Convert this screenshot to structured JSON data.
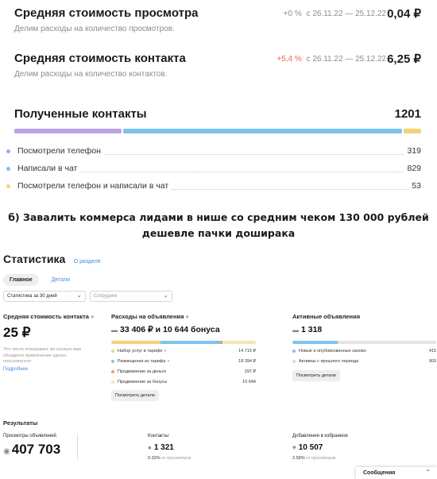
{
  "metrics": [
    {
      "title": "Средняя стоимость просмотра",
      "pct": "+0 %",
      "period": "с 26.11.22 — 25.12.22",
      "value": "0,04 ₽",
      "desc": "Делим расходы на количество просмотров.",
      "pct_color": "#8c8c8c"
    },
    {
      "title": "Средняя стоимость контакта",
      "pct": "+5,4 %",
      "period": "с 26.11.22 — 25.12.22",
      "value": "6,25 ₽",
      "desc": "Делим расходы на количество контактов.",
      "pct_color": "#e8694a"
    }
  ],
  "contacts": {
    "title": "Полученные контакты",
    "total": "1201",
    "rows": [
      {
        "label": "Посмотрели телефон",
        "value": "319",
        "color": "#b8a4e8"
      },
      {
        "label": "Написали в чат",
        "value": "829",
        "color": "#7ec2f0"
      },
      {
        "label": "Посмотрели телефон и написали в чат",
        "value": "53",
        "color": "#f5d178"
      }
    ]
  },
  "heading": "б) Завалить коммерса лидами в нише со средним чеком 130 000 рублей дешевле пачки доширака",
  "stats": {
    "title": "Статистика",
    "link": "О разделе",
    "tabs": [
      "Главное",
      "Детали"
    ],
    "period_select": "Статистика за 30 дней",
    "employee_select": "Сотрудник",
    "avg_contact": {
      "title": "Средняя стоимость контакта",
      "value": "25 ₽",
      "note": "Это число показывает, во сколько вам обходится привлечение одного пользователя",
      "more": "Подробнее"
    },
    "expenses": {
      "title": "Расходы на объявления",
      "value": "33 406 ₽ и 10 644 бонуса",
      "items": [
        {
          "label": "Набор услуг в тарифе",
          "value": "14 715 ₽",
          "color": "#f5d178"
        },
        {
          "label": "Размещения из тарифа",
          "value": "18 394 ₽",
          "color": "#7ec2f0"
        },
        {
          "label": "Продвижение за деньги",
          "value": "297 ₽",
          "color": "#f0a04b"
        },
        {
          "label": "Продвижение за бонусы",
          "value": "10 644",
          "color": "#f5e6b0"
        }
      ],
      "button": "Посмотреть детали"
    },
    "active_ads": {
      "title": "Активные объявления",
      "value": "1 318",
      "items": [
        {
          "label": "Новые и опубликованные заново",
          "value": "415",
          "color": "#7ec2f0"
        },
        {
          "label": "Активны с прошлого периода",
          "value": "903",
          "color": "#d9d9d9"
        }
      ],
      "button": "Посмотреть детали"
    }
  },
  "results": {
    "title": "Результаты",
    "views": {
      "label": "Просмотры объявлений",
      "value": "407 703"
    },
    "contacts": {
      "label": "Контакты",
      "value": "1 321",
      "sub_pct": "0.32%",
      "sub_text": "от просмотров"
    },
    "favorites": {
      "label": "Добавления в избранное",
      "value": "10 507",
      "sub_pct": "2.58%",
      "sub_text": "от просмотров"
    }
  },
  "messages": "Сообщения"
}
